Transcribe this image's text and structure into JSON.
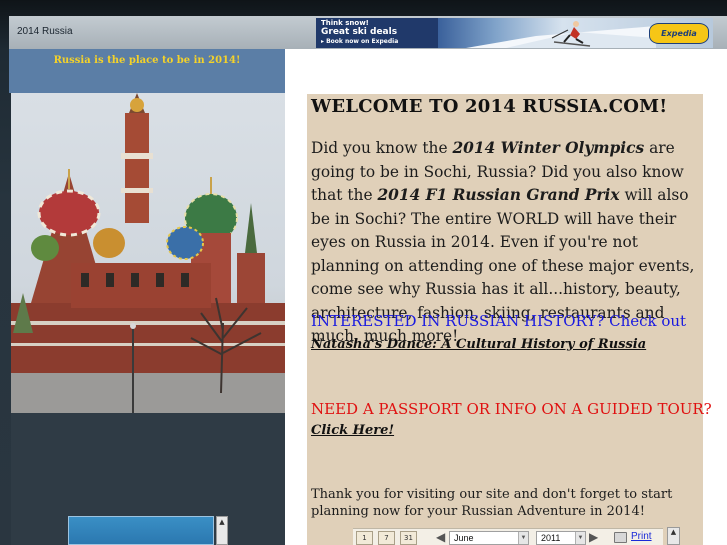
{
  "header": {
    "site_title": "2014 Russia"
  },
  "ad": {
    "line1": "Think snow!",
    "line2": "Great ski deals",
    "line3": "▸ Book now on Expedia",
    "brand": "Expedia"
  },
  "sidebar": {
    "tagline": "Russia is the place to be in 2014!"
  },
  "content": {
    "welcome": "WELCOME TO 2014 RUSSIA.COM!",
    "intro": {
      "p1": "Did you know the ",
      "olympics": "2014 Winter Olympics",
      "p2": "  are going to be in Sochi, Russia?  Did you also know that the ",
      "f1": "2014 F1  Russian Grand Prix",
      "p3": "  will also be in Sochi?  The entire WORLD will have their eyes on Russia in 2014.  Even if you're not planning on attending one of these major events, come see why Russia has it all...history, beauty, architecture, fashion, skiing, restaurants and much, much more!"
    },
    "history_prompt": "INTERESTED IN RUSSIAN HISTORY?  Check out",
    "book_link": "Natasha's Dance: A Cultural History of Russia",
    "passport_prompt": "NEED A PASSPORT OR INFO ON A GUIDED TOUR?",
    "click_here": "Click Here!",
    "thanks": "Thank you for visiting our site and don't forget to start planning now for your Russian Adventure in 2014!"
  },
  "calendar": {
    "view_day": "1",
    "view_week": "7",
    "view_month": "31",
    "month": "June",
    "year": "2011",
    "print_label": "Print"
  }
}
